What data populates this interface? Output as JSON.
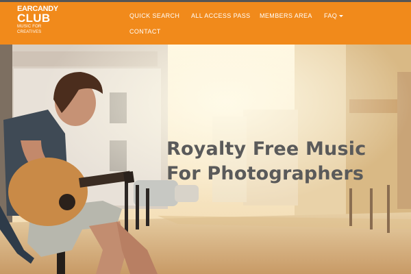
{
  "logo": {
    "top": "EARCANDY",
    "main": "CLUB",
    "tagline": "MUSIC FOR CREATIVES"
  },
  "nav": {
    "items": [
      {
        "label": "QUICK SEARCH"
      },
      {
        "label": "ALL ACCESS PASS"
      },
      {
        "label": "MEMBERS AREA"
      },
      {
        "label": "FAQ"
      },
      {
        "label": "CONTACT"
      }
    ]
  },
  "hero": {
    "title_line1": "Royalty Free Music",
    "title_line2": "For Photographers"
  },
  "colors": {
    "navbar": "#f18a1b",
    "nav_text": "#ffffff",
    "hero_title": "#5a5a5a"
  },
  "icons": {
    "faq_dropdown": "caret-down-icon"
  }
}
